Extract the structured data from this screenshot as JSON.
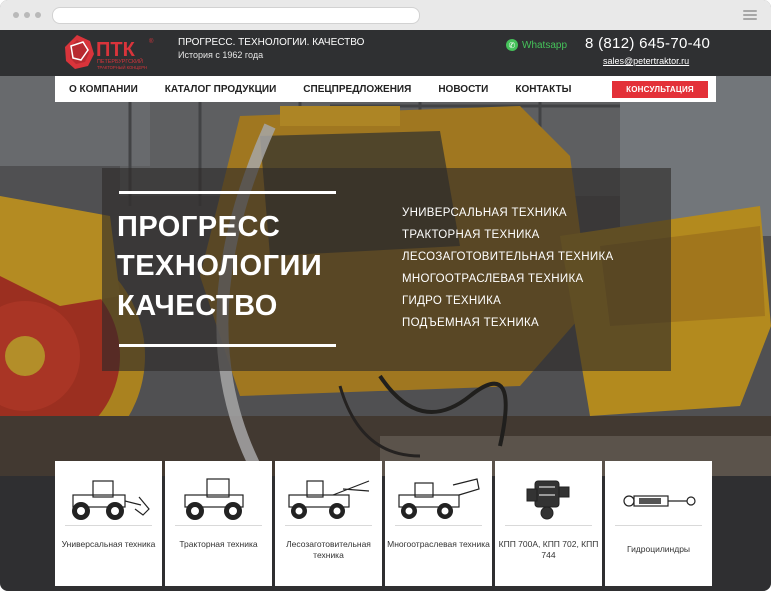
{
  "brand": {
    "logo_text": "ПТК",
    "logo_sub": "ПЕТЕРБУРГСКИЙ ТРАКТОРНЫЙ КОНЦЕРН",
    "tagline": "ПРОГРЕСС. ТЕХНОЛОГИИ. КАЧЕСТВО",
    "since": "История с 1962 года",
    "accent_color": "#e33038"
  },
  "contacts": {
    "whatsapp": "Whatsapp",
    "phone": "8 (812) 645-70-40",
    "email": "sales@petertraktor.ru"
  },
  "nav": {
    "items": [
      "О КОМПАНИИ",
      "КАТАЛОГ ПРОДУКЦИИ",
      "СПЕЦПРЕДЛОЖЕНИЯ",
      "НОВОСТИ",
      "КОНТАКТЫ"
    ],
    "cta": "КОНСУЛЬТАЦИЯ"
  },
  "hero": {
    "line1": "ПРОГРЕСС",
    "line2": "ТЕХНОЛОГИИ",
    "line3": "КАЧЕСТВО",
    "list": [
      "УНИВЕРСАЛЬНАЯ ТЕХНИКА",
      "ТРАКТОРНАЯ ТЕХНИКА",
      "ЛЕСОЗАГОТОВИТЕЛЬНАЯ ТЕХНИКА",
      "МНОГООТРАСЛЕВАЯ ТЕХНИКА",
      "ГИДРО ТЕХНИКА",
      "ПОДЪЕМНАЯ ТЕХНИКА"
    ]
  },
  "cards": [
    {
      "label": "Универсальная техника",
      "icon": "tractor-blade-icon"
    },
    {
      "label": "Тракторная техника",
      "icon": "tractor-icon"
    },
    {
      "label": "Лесозаготовительная техника",
      "icon": "forestry-machine-icon"
    },
    {
      "label": "Многоотраслевая техника",
      "icon": "multipurpose-machine-icon"
    },
    {
      "label": "КПП 700А, КПП 702, КПП 744",
      "icon": "gearbox-icon"
    },
    {
      "label": "Гидроцилиндры",
      "icon": "hydraulic-cylinder-icon"
    }
  ]
}
